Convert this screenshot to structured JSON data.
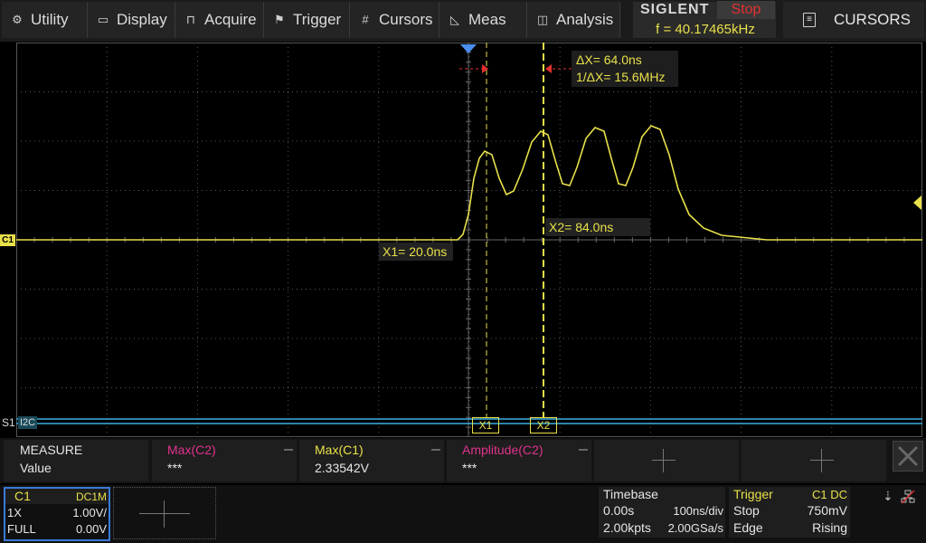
{
  "menu": {
    "utility": "Utility",
    "display": "Display",
    "acquire": "Acquire",
    "trigger": "Trigger",
    "cursors": "Cursors",
    "meas": "Meas",
    "analysis": "Analysis"
  },
  "brand": "SIGLENT",
  "run_state": "Stop",
  "frequency": "f = 40.17465kHz",
  "right_menu_title": "CURSORS",
  "cursors": {
    "x1_label": "X1",
    "x2_label": "X2",
    "x1_readout": "X1= 20.0ns",
    "x2_readout": "X2= 84.0ns",
    "delta_x": "ΔX= 64.0ns",
    "inv_delta_x": "1/ΔX= 15.6MHz"
  },
  "channel_marker": "C1",
  "serial_marker": "S1",
  "serial_protocol": "I2C",
  "measure": {
    "title": "MEASURE",
    "row_label": "Value",
    "items": [
      {
        "name": "Max(C2)",
        "value": "***",
        "color": "#e0338c"
      },
      {
        "name": "Max(C1)",
        "value": "2.33542V",
        "color": "#e8e04a"
      },
      {
        "name": "Amplitude(C2)",
        "value": "***",
        "color": "#e0338c"
      }
    ]
  },
  "channel": {
    "name": "C1",
    "coupling": "DC1M",
    "probe": "1X",
    "scale": "1.00V/",
    "bandwidth": "FULL",
    "offset": "0.00V"
  },
  "timebase": {
    "title": "Timebase",
    "delay": "0.00s",
    "scale": "100ns/div",
    "points": "2.00kpts",
    "rate": "2.00GSa/s"
  },
  "trigger": {
    "title": "Trigger",
    "source": "C1 DC",
    "mode": "Stop",
    "level": "750mV",
    "type": "Edge",
    "slope": "Rising"
  },
  "colors": {
    "channel1": "#e8e04a",
    "channel2": "#e0338c",
    "serial": "#3ab0e0",
    "stop": "#e43030",
    "trigger_pos": "#4a8ef0"
  }
}
